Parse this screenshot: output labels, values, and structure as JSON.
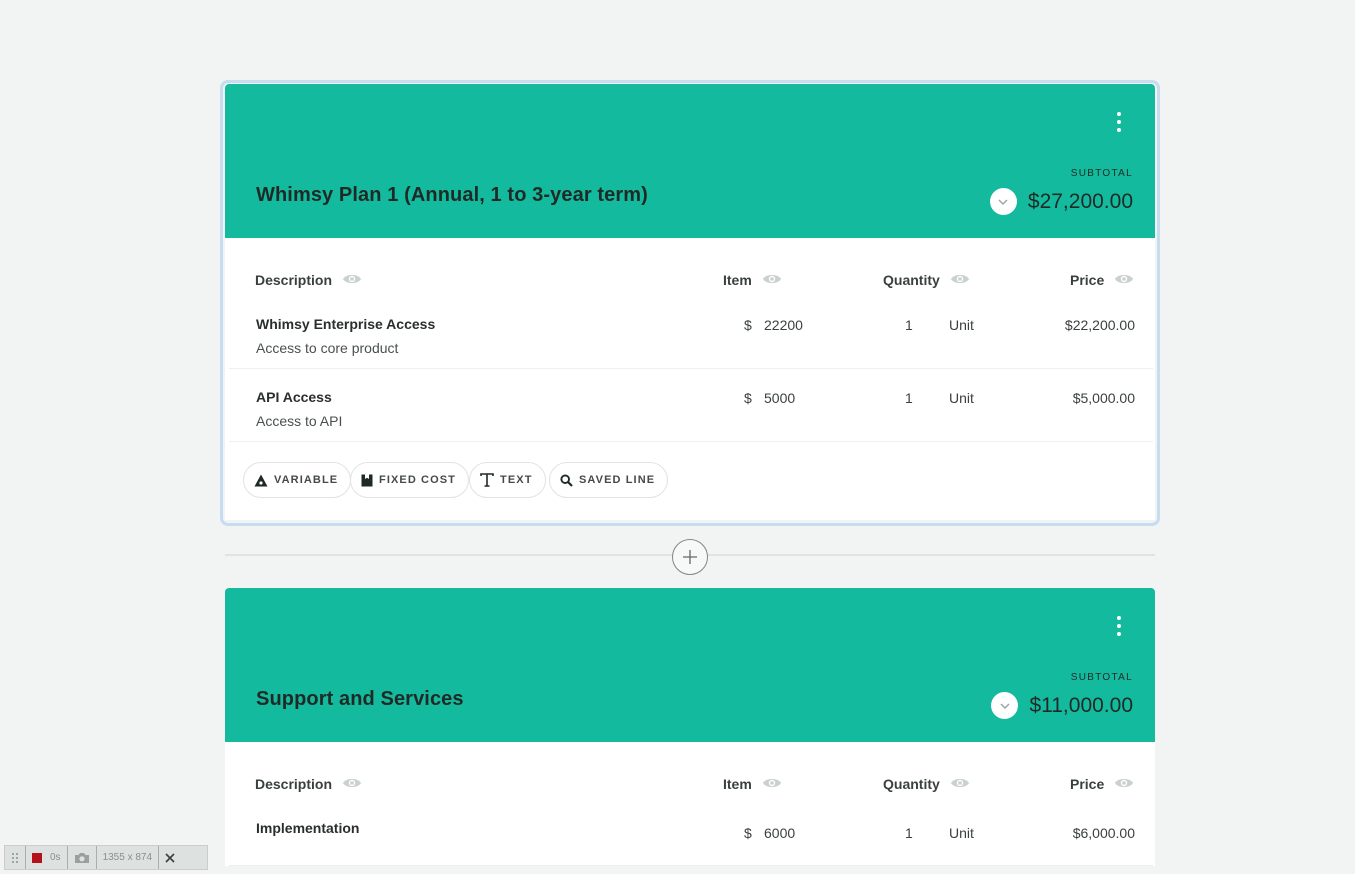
{
  "sections": [
    {
      "title": "Whimsy Plan 1 (Annual, 1 to 3-year term)",
      "subtotal_label": "SUBTOTAL",
      "subtotal": "$27,200.00",
      "columns": {
        "description": "Description",
        "item": "Item",
        "quantity": "Quantity",
        "price": "Price"
      },
      "lines": [
        {
          "title": "Whimsy Enterprise Access",
          "subtitle": "Access to core product",
          "currency": "$",
          "item": "22200",
          "quantity": "1",
          "unit": "Unit",
          "price": "$22,200.00"
        },
        {
          "title": "API Access",
          "subtitle": "Access to API",
          "currency": "$",
          "item": "5000",
          "quantity": "1",
          "unit": "Unit",
          "price": "$5,000.00"
        }
      ],
      "add_buttons": {
        "variable": "VARIABLE",
        "fixed_cost": "FIXED COST",
        "text": "TEXT",
        "saved_line": "SAVED LINE"
      }
    },
    {
      "title": "Support and Services",
      "subtotal_label": "SUBTOTAL",
      "subtotal": "$11,000.00",
      "columns": {
        "description": "Description",
        "item": "Item",
        "quantity": "Quantity",
        "price": "Price"
      },
      "lines": [
        {
          "title": "Implementation",
          "currency": "$",
          "item": "6000",
          "quantity": "1",
          "unit": "Unit",
          "price": "$6,000.00"
        }
      ]
    }
  ],
  "recorder": {
    "time": "0s",
    "size": "1355 x 874"
  },
  "colors": {
    "header": "#13ba9d",
    "background": "#f1f4f3",
    "focus": "#c6dcf0"
  },
  "icons": [
    "kebab-menu-icon",
    "chevron-down-icon",
    "eye-icon",
    "variable-icon",
    "fixed-cost-icon",
    "text-icon",
    "search-icon",
    "plus-icon",
    "drag-handle-icon",
    "record-stop-icon",
    "camera-icon",
    "close-icon"
  ]
}
